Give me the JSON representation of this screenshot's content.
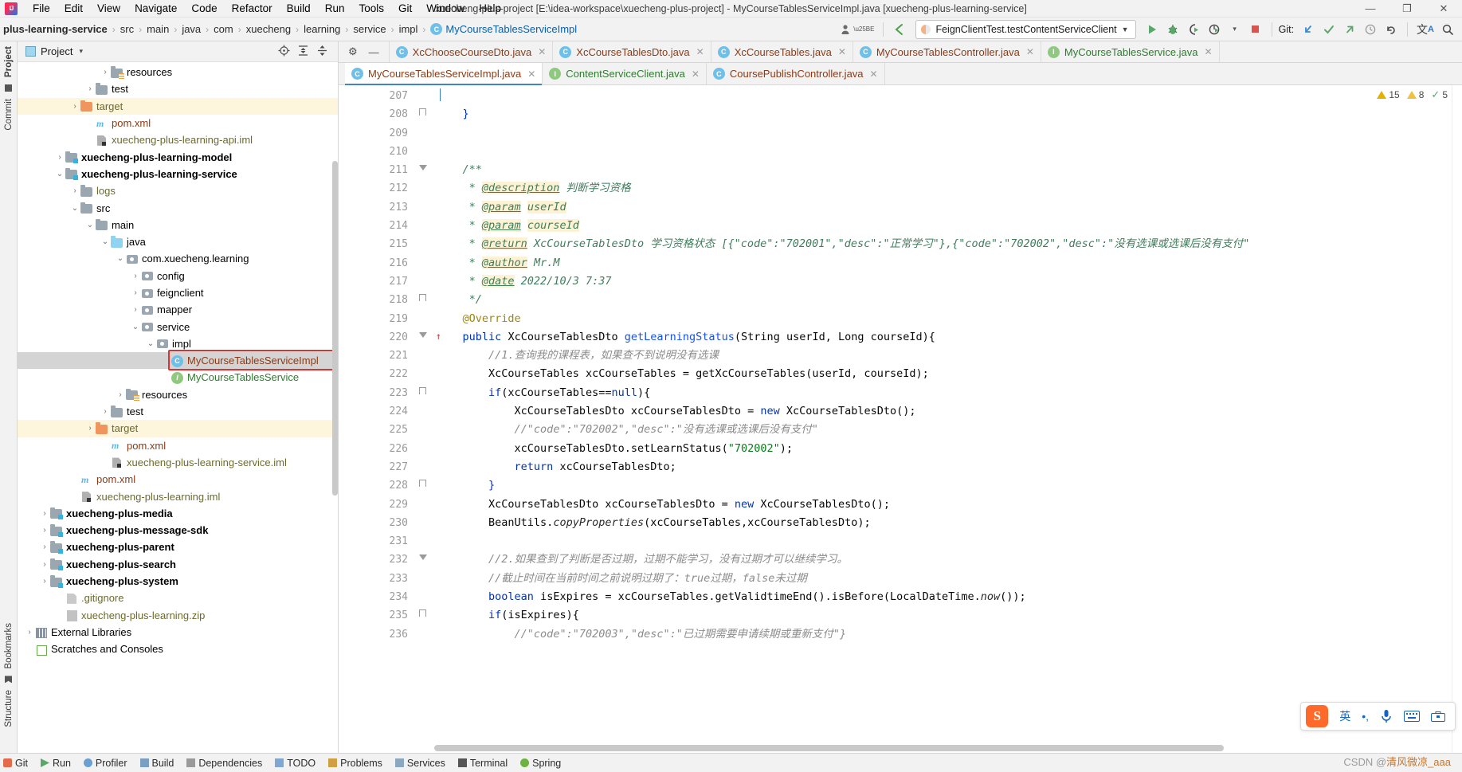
{
  "window": {
    "title": "xuecheng-plus-project [E:\\idea-workspace\\xuecheng-plus-project] - MyCourseTablesServiceImpl.java [xuecheng-plus-learning-service]",
    "minimize": "—",
    "maximize": "❐",
    "close": "✕"
  },
  "menu": {
    "items": [
      "File",
      "Edit",
      "View",
      "Navigate",
      "Code",
      "Refactor",
      "Build",
      "Run",
      "Tools",
      "Git",
      "Window",
      "Help"
    ]
  },
  "breadcrumb": {
    "items": [
      {
        "label": "plus-learning-service",
        "bold": true
      },
      {
        "label": "src",
        "bold": false
      },
      {
        "label": "main",
        "bold": false
      },
      {
        "label": "java",
        "bold": false
      },
      {
        "label": "com",
        "bold": false
      },
      {
        "label": "xuecheng",
        "bold": false
      },
      {
        "label": "learning",
        "bold": false
      },
      {
        "label": "service",
        "bold": false
      },
      {
        "label": "impl",
        "bold": false
      }
    ],
    "file": "MyCourseTablesServiceImpl",
    "file_badge": "C",
    "separator": "›"
  },
  "toolbar": {
    "run_config": "FeignClientTest.testContentServiceClient",
    "run_config_caret": "▼",
    "run": "▶",
    "debug": "debug-icon",
    "coverage": "coverage-icon",
    "profile": "profile-icon",
    "stop": "■",
    "git_label": "Git:",
    "git_update": "↙",
    "git_commit": "✓",
    "git_push": "↗",
    "git_history": "◴",
    "git_rollback": "↶",
    "translate": "文A",
    "search": "⌕",
    "profiler_caret": "▾",
    "back_arrow": "↖",
    "user_icon": "user-icon"
  },
  "left_strip": {
    "tabs": [
      "Project",
      "Commit",
      "Bookmarks",
      "Structure"
    ]
  },
  "project_panel": {
    "title": "Project",
    "caret": "▾",
    "actions": [
      "locate-icon",
      "expand-all-icon",
      "collapse-all-icon",
      "settings-icon",
      "hide-icon"
    ],
    "tree": [
      {
        "indent": 5,
        "arrow": "›",
        "icon": "folder-resources",
        "label": "resources",
        "color": "dark",
        "bold": false,
        "state": "none"
      },
      {
        "indent": 4,
        "arrow": "›",
        "icon": "folder-gray",
        "label": "test",
        "color": "dark",
        "bold": false,
        "state": "none"
      },
      {
        "indent": 3,
        "arrow": "›",
        "icon": "folder-orange",
        "label": "target",
        "color": "olive",
        "bold": false,
        "state": "hl"
      },
      {
        "indent": 4,
        "arrow": "",
        "icon": "maven-m",
        "label": "pom.xml",
        "color": "brown",
        "bold": false,
        "state": "none"
      },
      {
        "indent": 4,
        "arrow": "",
        "icon": "iml",
        "label": "xuecheng-plus-learning-api.iml",
        "color": "olive",
        "bold": false,
        "state": "none"
      },
      {
        "indent": 2,
        "arrow": "›",
        "icon": "folder-module",
        "label": "xuecheng-plus-learning-model",
        "color": "dark",
        "bold": true,
        "state": "none"
      },
      {
        "indent": 2,
        "arrow": "⌄",
        "icon": "folder-module",
        "label": "xuecheng-plus-learning-service",
        "color": "dark",
        "bold": true,
        "state": "none"
      },
      {
        "indent": 3,
        "arrow": "›",
        "icon": "folder-gray",
        "label": "logs",
        "color": "olive",
        "bold": false,
        "state": "none"
      },
      {
        "indent": 3,
        "arrow": "⌄",
        "icon": "folder-gray",
        "label": "src",
        "color": "dark",
        "bold": false,
        "state": "none"
      },
      {
        "indent": 4,
        "arrow": "⌄",
        "icon": "folder-gray",
        "label": "main",
        "color": "dark",
        "bold": false,
        "state": "none"
      },
      {
        "indent": 5,
        "arrow": "⌄",
        "icon": "folder-blue",
        "label": "java",
        "color": "dark",
        "bold": false,
        "state": "none"
      },
      {
        "indent": 6,
        "arrow": "⌄",
        "icon": "package",
        "label": "com.xuecheng.learning",
        "color": "dark",
        "bold": false,
        "state": "none"
      },
      {
        "indent": 7,
        "arrow": "›",
        "icon": "package",
        "label": "config",
        "color": "dark",
        "bold": false,
        "state": "none"
      },
      {
        "indent": 7,
        "arrow": "›",
        "icon": "package",
        "label": "feignclient",
        "color": "dark",
        "bold": false,
        "state": "none"
      },
      {
        "indent": 7,
        "arrow": "›",
        "icon": "package",
        "label": "mapper",
        "color": "dark",
        "bold": false,
        "state": "none"
      },
      {
        "indent": 7,
        "arrow": "⌄",
        "icon": "package",
        "label": "service",
        "color": "dark",
        "bold": false,
        "state": "none"
      },
      {
        "indent": 8,
        "arrow": "⌄",
        "icon": "package",
        "label": "impl",
        "color": "dark",
        "bold": false,
        "state": "none"
      },
      {
        "indent": 9,
        "arrow": "",
        "icon": "class",
        "label": "MyCourseTablesServiceImpl",
        "color": "brown",
        "bold": false,
        "state": "sel"
      },
      {
        "indent": 9,
        "arrow": "",
        "icon": "interface",
        "label": "MyCourseTablesService",
        "color": "green",
        "bold": false,
        "state": "none"
      },
      {
        "indent": 6,
        "arrow": "›",
        "icon": "folder-resources",
        "label": "resources",
        "color": "dark",
        "bold": false,
        "state": "none"
      },
      {
        "indent": 5,
        "arrow": "›",
        "icon": "folder-gray",
        "label": "test",
        "color": "dark",
        "bold": false,
        "state": "none"
      },
      {
        "indent": 4,
        "arrow": "›",
        "icon": "folder-orange",
        "label": "target",
        "color": "olive",
        "bold": false,
        "state": "hl"
      },
      {
        "indent": 5,
        "arrow": "",
        "icon": "maven-m",
        "label": "pom.xml",
        "color": "brown",
        "bold": false,
        "state": "none"
      },
      {
        "indent": 5,
        "arrow": "",
        "icon": "iml",
        "label": "xuecheng-plus-learning-service.iml",
        "color": "olive",
        "bold": false,
        "state": "none"
      },
      {
        "indent": 3,
        "arrow": "",
        "icon": "maven-m",
        "label": "pom.xml",
        "color": "brown",
        "bold": false,
        "state": "none"
      },
      {
        "indent": 3,
        "arrow": "",
        "icon": "iml",
        "label": "xuecheng-plus-learning.iml",
        "color": "olive",
        "bold": false,
        "state": "none"
      },
      {
        "indent": 1,
        "arrow": "›",
        "icon": "folder-module",
        "label": "xuecheng-plus-media",
        "color": "dark",
        "bold": true,
        "state": "none"
      },
      {
        "indent": 1,
        "arrow": "›",
        "icon": "folder-module",
        "label": "xuecheng-plus-message-sdk",
        "color": "dark",
        "bold": true,
        "state": "none"
      },
      {
        "indent": 1,
        "arrow": "›",
        "icon": "folder-module",
        "label": "xuecheng-plus-parent",
        "color": "dark",
        "bold": true,
        "state": "none"
      },
      {
        "indent": 1,
        "arrow": "›",
        "icon": "folder-module",
        "label": "xuecheng-plus-search",
        "color": "dark",
        "bold": true,
        "state": "none"
      },
      {
        "indent": 1,
        "arrow": "›",
        "icon": "folder-module",
        "label": "xuecheng-plus-system",
        "color": "dark",
        "bold": true,
        "state": "none"
      },
      {
        "indent": 2,
        "arrow": "",
        "icon": "gitignore",
        "label": ".gitignore",
        "color": "olive",
        "bold": false,
        "state": "none"
      },
      {
        "indent": 2,
        "arrow": "",
        "icon": "zip",
        "label": "xuecheng-plus-learning.zip",
        "color": "olive",
        "bold": false,
        "state": "none"
      },
      {
        "indent": 0,
        "arrow": "›",
        "icon": "library",
        "label": "External Libraries",
        "color": "dark",
        "bold": false,
        "state": "none"
      },
      {
        "indent": 0,
        "arrow": "",
        "icon": "scratch",
        "label": "Scratches and Consoles",
        "color": "dark",
        "bold": false,
        "state": "none"
      }
    ]
  },
  "editor": {
    "tabs_row1": [
      {
        "label": "XcChooseCourseDto.java",
        "kind": "class",
        "badge": "C",
        "active": false
      },
      {
        "label": "XcCourseTablesDto.java",
        "kind": "class",
        "badge": "C",
        "active": false
      },
      {
        "label": "XcCourseTables.java",
        "kind": "class",
        "badge": "C",
        "active": false
      },
      {
        "label": "MyCourseTablesController.java",
        "kind": "class",
        "badge": "C",
        "active": false
      },
      {
        "label": "MyCourseTablesService.java",
        "kind": "interface",
        "badge": "I",
        "active": false
      }
    ],
    "tabs_row2": [
      {
        "label": "MyCourseTablesServiceImpl.java",
        "kind": "class",
        "badge": "C",
        "active": true
      },
      {
        "label": "ContentServiceClient.java",
        "kind": "interface",
        "badge": "I",
        "active": false
      },
      {
        "label": "CoursePublishController.java",
        "kind": "class",
        "badge": "C",
        "active": false
      }
    ],
    "close_glyph": "✕",
    "gear": "⚙",
    "minus": "—",
    "inspections": {
      "warnings": "15",
      "weak_warnings": "8",
      "ok": "5"
    },
    "first_line": 207,
    "lines": [
      {
        "n": 207,
        "fold": "",
        "html": ""
      },
      {
        "n": 208,
        "fold": "collapse",
        "html": "    <span class='brace'>}</span>"
      },
      {
        "n": 209,
        "fold": "",
        "html": ""
      },
      {
        "n": 210,
        "fold": "",
        "html": ""
      },
      {
        "n": 211,
        "fold": "expand",
        "html": "    <span class='jd'>/**</span>"
      },
      {
        "n": 212,
        "fold": "",
        "html": "     <span class='jd'>* </span><span class='jdtag'>@description</span><span class='jd'> 判断学习资格</span>"
      },
      {
        "n": 213,
        "fold": "",
        "html": "     <span class='jd'>* </span><span class='jdtag'>@param</span><span class='jd'> </span><span class='jdparam'>userId</span>"
      },
      {
        "n": 214,
        "fold": "",
        "html": "     <span class='jd'>* </span><span class='jdtag'>@param</span><span class='jd'> </span><span class='jdparam'>courseId</span>"
      },
      {
        "n": 215,
        "fold": "",
        "html": "     <span class='jd'>* </span><span class='jdtag'>@return</span><span class='jd'> XcCourseTablesDto 学习资格状态 [{\"code\":\"702001\",\"desc\":\"正常学习\"},{\"code\":\"702002\",\"desc\":\"没有选课或选课后没有支付\"</span>"
      },
      {
        "n": 216,
        "fold": "",
        "html": "     <span class='jd'>* </span><span class='jdtag'>@author</span><span class='jd'> Mr.M</span>"
      },
      {
        "n": 217,
        "fold": "",
        "html": "     <span class='jd'>* </span><span class='jdtag'>@date</span><span class='jd'> 2022/10/3 7:37</span>"
      },
      {
        "n": 218,
        "fold": "collapse",
        "html": "     <span class='jd'>*/</span>"
      },
      {
        "n": 219,
        "fold": "",
        "html": "    <span class='an'>@Override</span>"
      },
      {
        "n": 220,
        "fold": "expand",
        "html": "    <span class='k'>public</span> <span class='n'>XcCourseTablesDto</span> <span class='mth'>getLearningStatus</span><span class='n'>(String userId, Long courseId){</span>"
      },
      {
        "n": 221,
        "fold": "",
        "html": "        <span class='cm'>//1.查询我的课程表，如果查不到说明没有选课</span>"
      },
      {
        "n": 222,
        "fold": "",
        "html": "        <span class='n'>XcCourseTables xcCourseTables = getXcCourseTables(userId, courseId);</span>"
      },
      {
        "n": 223,
        "fold": "collapse",
        "html": "        <span class='k'>if</span><span class='n'>(xcCourseTables==</span><span class='k'>null</span><span class='n'>){</span>"
      },
      {
        "n": 224,
        "fold": "",
        "html": "            <span class='n'>XcCourseTablesDto xcCourseTablesDto = </span><span class='k'>new</span><span class='n'> XcCourseTablesDto();</span>"
      },
      {
        "n": 225,
        "fold": "",
        "html": "            <span class='cm'>//\"code\":\"702002\",\"desc\":\"没有选课或选课后没有支付\"</span>"
      },
      {
        "n": 226,
        "fold": "",
        "html": "            <span class='n'>xcCourseTablesDto.setLearnStatus(</span><span class='s'>\"702002\"</span><span class='n'>);</span>"
      },
      {
        "n": 227,
        "fold": "",
        "html": "            <span class='k'>return</span><span class='n'> xcCourseTablesDto;</span>"
      },
      {
        "n": 228,
        "fold": "collapse",
        "html": "        <span class='brace'>}</span>"
      },
      {
        "n": 229,
        "fold": "",
        "html": "        <span class='n'>XcCourseTablesDto xcCourseTablesDto = </span><span class='k'>new</span><span class='n'> XcCourseTablesDto();</span>"
      },
      {
        "n": 230,
        "fold": "",
        "html": "        <span class='n'>BeanUtils.</span><span class='fld'>copyProperties</span><span class='n'>(xcCourseTables,xcCourseTablesDto);</span>"
      },
      {
        "n": 231,
        "fold": "",
        "html": ""
      },
      {
        "n": 232,
        "fold": "expand",
        "html": "        <span class='cm'>//2.如果查到了判断是否过期，过期不能学习，没有过期才可以继续学习。</span>"
      },
      {
        "n": 233,
        "fold": "",
        "html": "        <span class='cm'>//截止时间在当前时间之前说明过期了：true过期，false未过期</span>"
      },
      {
        "n": 234,
        "fold": "",
        "html": "        <span class='k'>boolean</span><span class='n'> isExpires = xcCourseTables.getValidtimeEnd().isBefore(LocalDateTime.</span><span class='fld'>now</span><span class='n'>());</span>"
      },
      {
        "n": 235,
        "fold": "collapse",
        "html": "        <span class='k'>if</span><span class='n'>(isExpires){</span>"
      },
      {
        "n": 236,
        "fold": "",
        "html": "            <span class='cm'>//\"code\":\"702003\",\"desc\":\"已过期需要申请续期或重新支付\"}</span>"
      }
    ]
  },
  "ime": {
    "logo": "S",
    "mode": "英",
    "dots": "•,",
    "mic": "mic-icon",
    "keyboard": "keyboard-icon",
    "toolbox": "toolbox-icon"
  },
  "watermark": {
    "prefix": "CSDN @",
    "name": "清风微凉_aaa"
  },
  "statusbar": {
    "items": [
      "Git",
      "Run",
      "Profiler",
      "Build",
      "Dependencies",
      "TODO",
      "Problems",
      "Services",
      "Terminal",
      "Spring"
    ]
  }
}
